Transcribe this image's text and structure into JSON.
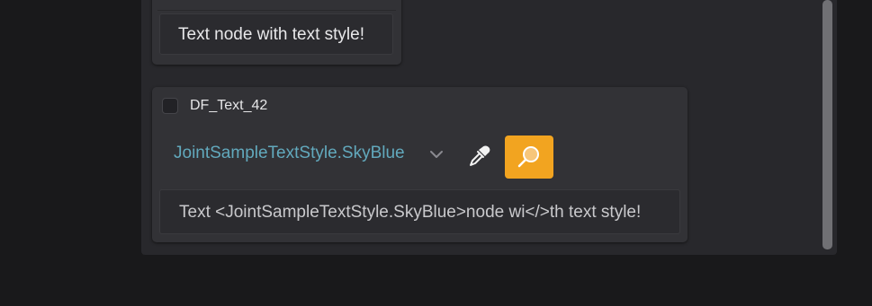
{
  "nodes": {
    "first": {
      "preview_text": "Text node with text style!"
    },
    "second": {
      "title": "DF_Text_42",
      "style_value": "JointSampleTextStyle.SkyBlue",
      "preview_text": "Text <JointSampleTextStyle.SkyBlue>node wi</>th text style!"
    }
  },
  "colors": {
    "background": "#19191b",
    "panel": "#28282c",
    "node": "#323236",
    "accent_button": "#f2a420",
    "style_text": "#62a9bd"
  },
  "icons": {
    "chevron": "chevron-down-icon",
    "eyedropper": "eyedropper-icon",
    "inspect": "magnifier-icon"
  }
}
